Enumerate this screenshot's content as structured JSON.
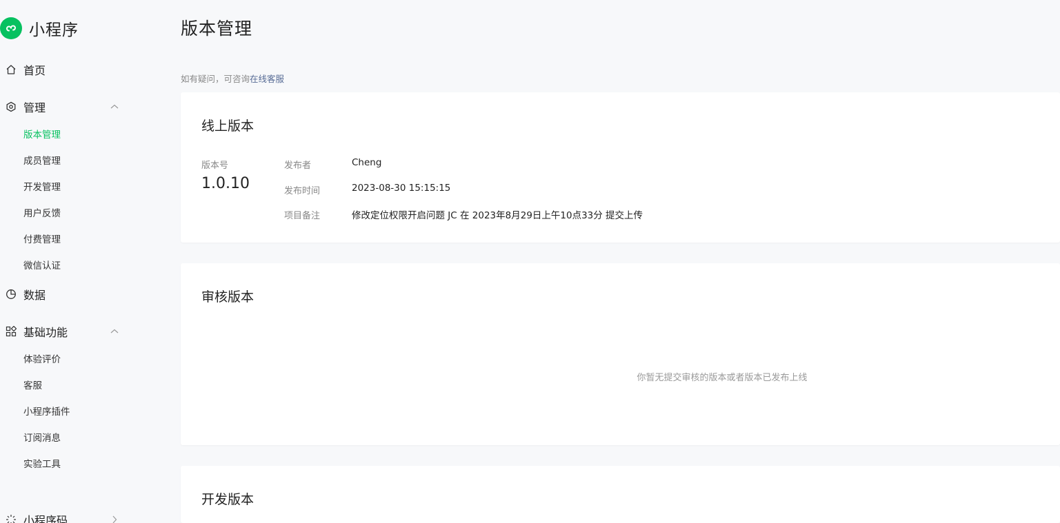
{
  "brand": {
    "name": "小程序"
  },
  "sidebar": {
    "home": "首页",
    "manage": {
      "label": "管理",
      "items": [
        "版本管理",
        "成员管理",
        "开发管理",
        "用户反馈",
        "付费管理",
        "微信认证"
      ]
    },
    "data": "数据",
    "basic": {
      "label": "基础功能",
      "items": [
        "体验评价",
        "客服",
        "小程序插件",
        "订阅消息",
        "实验工具"
      ]
    },
    "qrcode": "小程序码"
  },
  "page": {
    "title": "版本管理",
    "help_prefix": "如有疑问，可咨询",
    "help_link": "在线客服"
  },
  "online_version": {
    "title": "线上版本",
    "version_label": "版本号",
    "version": "1.0.10",
    "publisher_label": "发布者",
    "publisher": "Cheng",
    "time_label": "发布时间",
    "time": "2023-08-30 15:15:15",
    "note_label": "项目备注",
    "note": "修改定位权限开启问题 JC 在 2023年8月29日上午10点33分 提交上传"
  },
  "review_version": {
    "title": "审核版本",
    "empty": "你暂无提交审核的版本或者版本已发布上线"
  },
  "dev_version": {
    "title": "开发版本"
  },
  "colors": {
    "accent": "#07c160",
    "link": "#576b95",
    "background": "#f7f8fa"
  }
}
